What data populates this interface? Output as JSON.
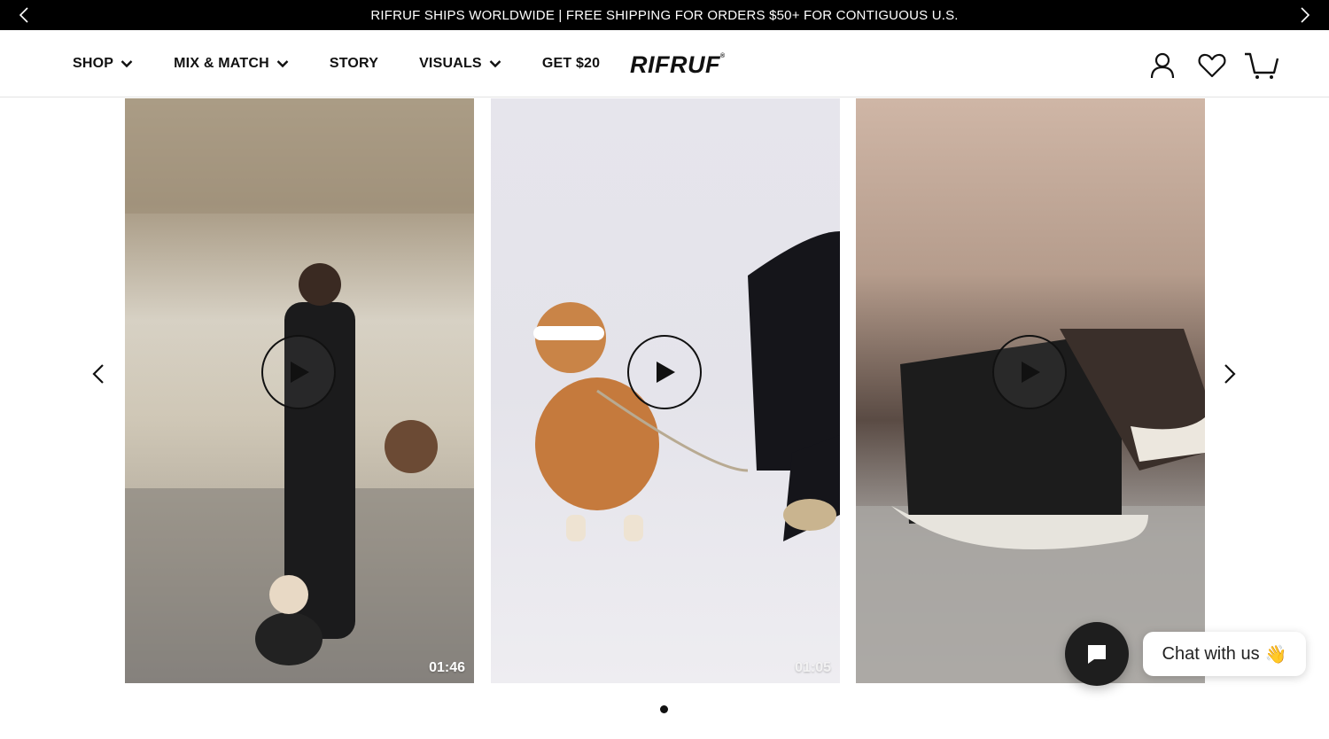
{
  "announcement": {
    "text": "RIFRUF SHIPS WORLDWIDE | FREE SHIPPING FOR ORDERS $50+ FOR CONTIGUOUS U.S.",
    "prev_icon": "chevron-left-icon",
    "next_icon": "chevron-right-icon"
  },
  "header": {
    "nav": [
      {
        "label": "SHOP",
        "has_dropdown": true
      },
      {
        "label": "MIX & MATCH",
        "has_dropdown": true
      },
      {
        "label": "STORY",
        "has_dropdown": false
      },
      {
        "label": "VISUALS",
        "has_dropdown": true
      },
      {
        "label": "GET $20",
        "has_dropdown": false
      }
    ],
    "logo": "RIFRUF",
    "logo_mark": "®",
    "icons": [
      "account-icon",
      "wishlist-heart-icon",
      "cart-icon"
    ]
  },
  "carousel": {
    "slides": [
      {
        "duration": "01:46",
        "icon": "play-icon"
      },
      {
        "duration": "01:05",
        "icon": "play-icon"
      },
      {
        "duration": "",
        "icon": "play-icon"
      }
    ],
    "prev_icon": "chevron-left-icon",
    "next_icon": "chevron-right-icon",
    "dots": 1,
    "active_dot": 0
  },
  "chat": {
    "label": "Chat with us",
    "emoji": "👋",
    "button_icon": "chat-bubble-icon"
  },
  "colors": {
    "announcement_bg": "#000000",
    "text": "#111111",
    "chat_button_bg": "#1e1e1e"
  }
}
